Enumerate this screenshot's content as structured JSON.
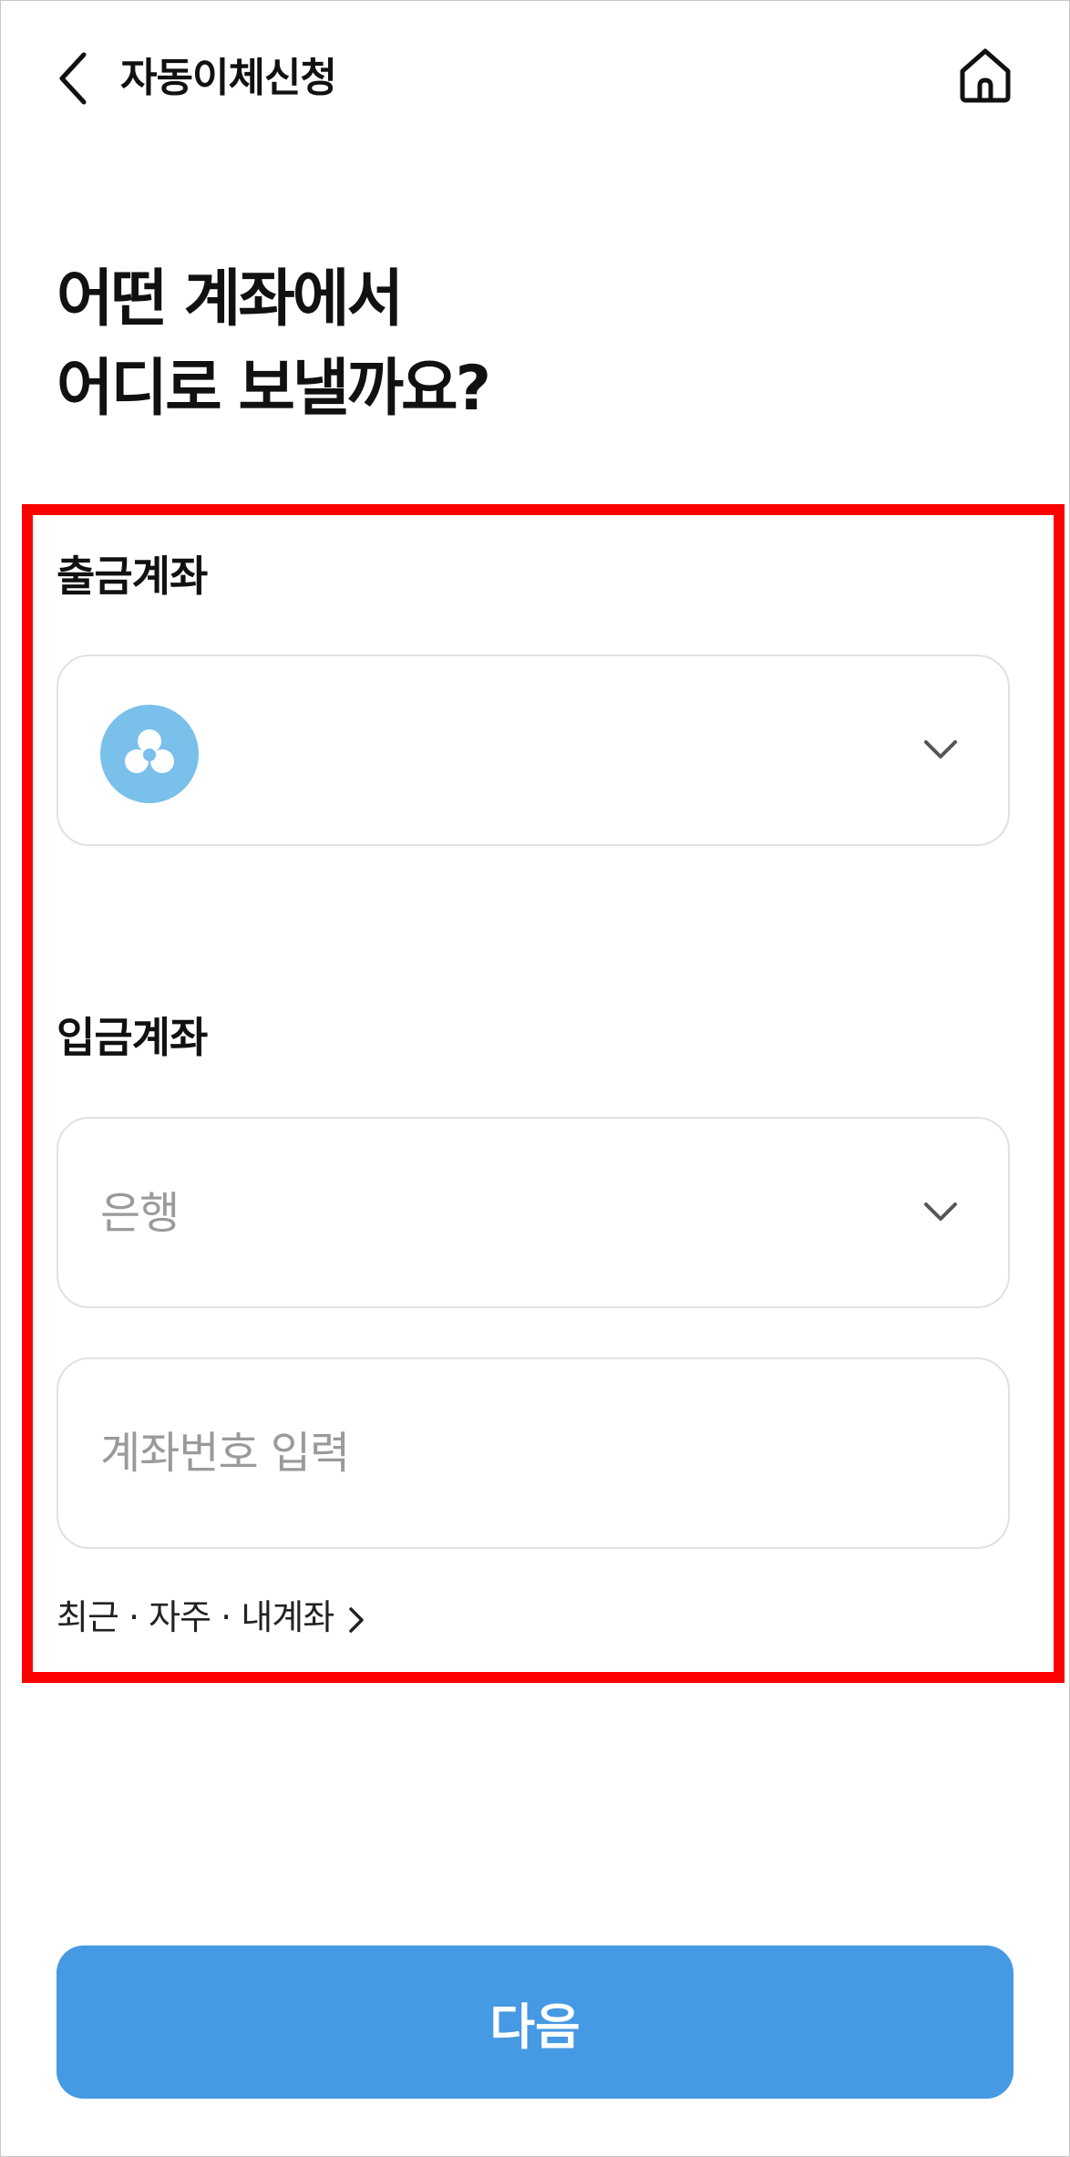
{
  "header": {
    "title": "자동이체신청",
    "back_icon": "chevron-left-icon",
    "home_icon": "home-icon"
  },
  "headline": {
    "line1": "어떤 계좌에서",
    "line2": "어디로 보낼까요?"
  },
  "withdrawal": {
    "label": "출금계좌",
    "bank_logo_icon": "bank-logo-icon",
    "bank_logo_color": "#79c0eb",
    "dropdown_icon": "chevron-down-icon"
  },
  "deposit": {
    "label": "입금계좌",
    "bank_select_placeholder": "은행",
    "dropdown_icon": "chevron-down-icon",
    "account_placeholder": "계좌번호 입력",
    "account_value": ""
  },
  "shortcuts": {
    "label": "최근 · 자주 · 내계좌",
    "icon": "chevron-right-icon"
  },
  "footer": {
    "next_label": "다음",
    "button_color": "#4699e3"
  },
  "highlight_color": "#ff0000"
}
